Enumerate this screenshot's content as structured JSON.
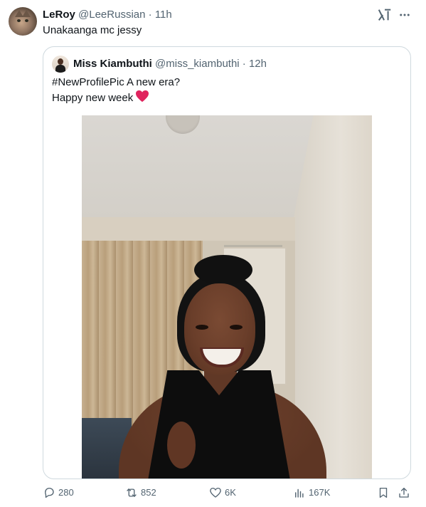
{
  "tweet": {
    "author_name": "LeRoy",
    "author_handle": "@LeeRussian",
    "separator": "·",
    "time": "11h",
    "text": "Unakaanga mc jessy"
  },
  "quoted": {
    "author_name": "Miss Kiambuthi",
    "author_handle": "@miss_kiambuthi",
    "separator": "·",
    "time": "12h",
    "line1": "#NewProfilePic A new era?",
    "line2": "Happy new week"
  },
  "actions": {
    "replies": "280",
    "reposts": "852",
    "likes": "6K",
    "views": "167K"
  },
  "icons": {
    "grok": "grok-icon",
    "more": "more-icon",
    "reply": "reply-icon",
    "repost": "repost-icon",
    "like": "heart-icon",
    "views": "views-icon",
    "bookmark": "bookmark-icon",
    "share": "share-icon"
  },
  "colors": {
    "text": "#0f1419",
    "muted": "#536471",
    "border": "#cfd9de",
    "heart_emoji": "#e0245e"
  }
}
